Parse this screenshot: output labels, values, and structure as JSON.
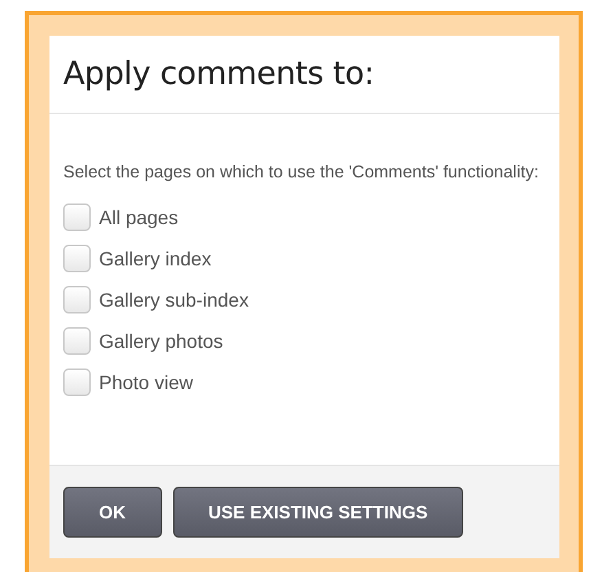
{
  "dialog": {
    "title": "Apply comments to:",
    "instruction": "Select the pages on which to use the 'Comments' functionality:",
    "options": [
      {
        "label": "All pages",
        "checked": false
      },
      {
        "label": "Gallery index",
        "checked": false
      },
      {
        "label": "Gallery sub-index",
        "checked": false
      },
      {
        "label": "Gallery photos",
        "checked": false
      },
      {
        "label": "Photo view",
        "checked": false
      }
    ],
    "buttons": [
      "OK",
      "USE EXISTING SETTINGS"
    ]
  }
}
